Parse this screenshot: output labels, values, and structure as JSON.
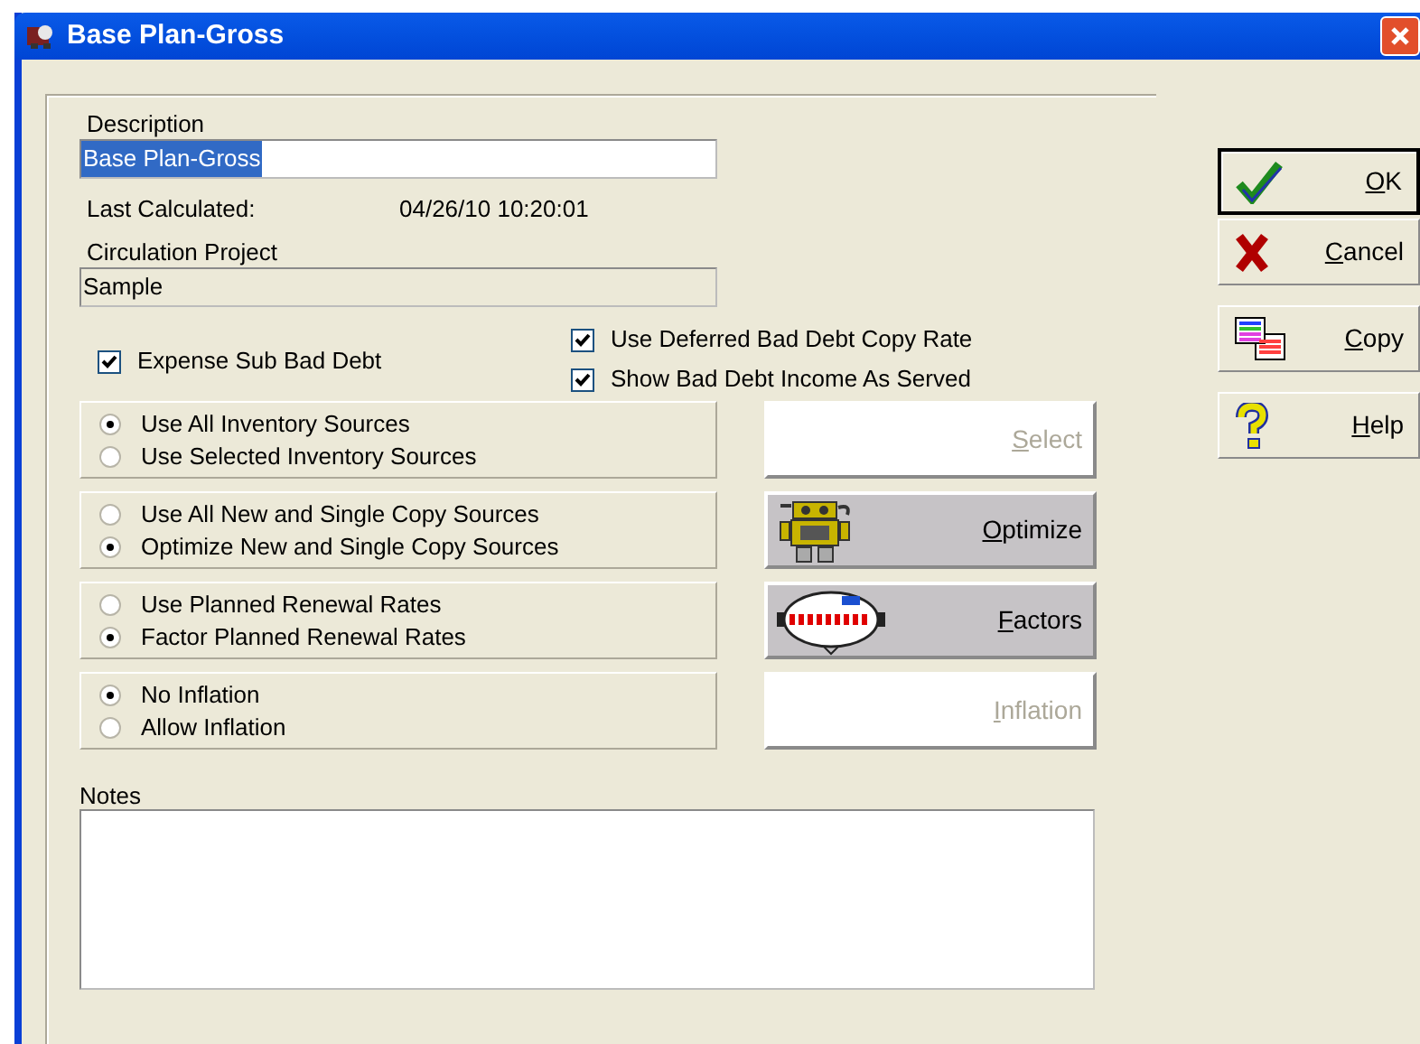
{
  "window": {
    "title": "Base Plan-Gross"
  },
  "description": {
    "label": "Description",
    "value": "Base Plan-Gross",
    "selected": true
  },
  "last_calculated": {
    "label": "Last Calculated:",
    "value": "04/26/10 10:20:01"
  },
  "circulation_project": {
    "label": "Circulation Project",
    "value": "Sample",
    "disabled": true
  },
  "checkboxes": [
    {
      "label": "Expense Sub Bad Debt",
      "checked": true
    },
    {
      "label": "Use Deferred Bad Debt Copy Rate",
      "checked": true
    },
    {
      "label": "Show Bad Debt Income As Served",
      "checked": true
    }
  ],
  "option_groups": [
    {
      "options": [
        {
          "label": "Use All Inventory Sources",
          "selected": true
        },
        {
          "label": "Use Selected Inventory Sources",
          "selected": false
        }
      ],
      "button": {
        "label": "Select",
        "disabled": true
      }
    },
    {
      "options": [
        {
          "label": "Use All New and Single Copy Sources",
          "selected": false
        },
        {
          "label": "Optimize New and Single Copy Sources",
          "selected": true
        }
      ],
      "button": {
        "label": "Optimize",
        "disabled": false
      }
    },
    {
      "options": [
        {
          "label": "Use Planned Renewal Rates",
          "selected": false
        },
        {
          "label": "Factor Planned Renewal Rates",
          "selected": true
        }
      ],
      "button": {
        "label": "Factors",
        "disabled": false
      }
    },
    {
      "options": [
        {
          "label": "No Inflation",
          "selected": true
        },
        {
          "label": "Allow Inflation",
          "selected": false
        }
      ],
      "button": {
        "label": "Inflation",
        "disabled": true
      }
    }
  ],
  "notes": {
    "label": "Notes"
  },
  "dialog_buttons": [
    {
      "label": "OK",
      "default": true
    },
    {
      "label": "Cancel",
      "default": false
    },
    {
      "label": "Copy",
      "default": false
    },
    {
      "label": "Help",
      "default": false
    }
  ]
}
